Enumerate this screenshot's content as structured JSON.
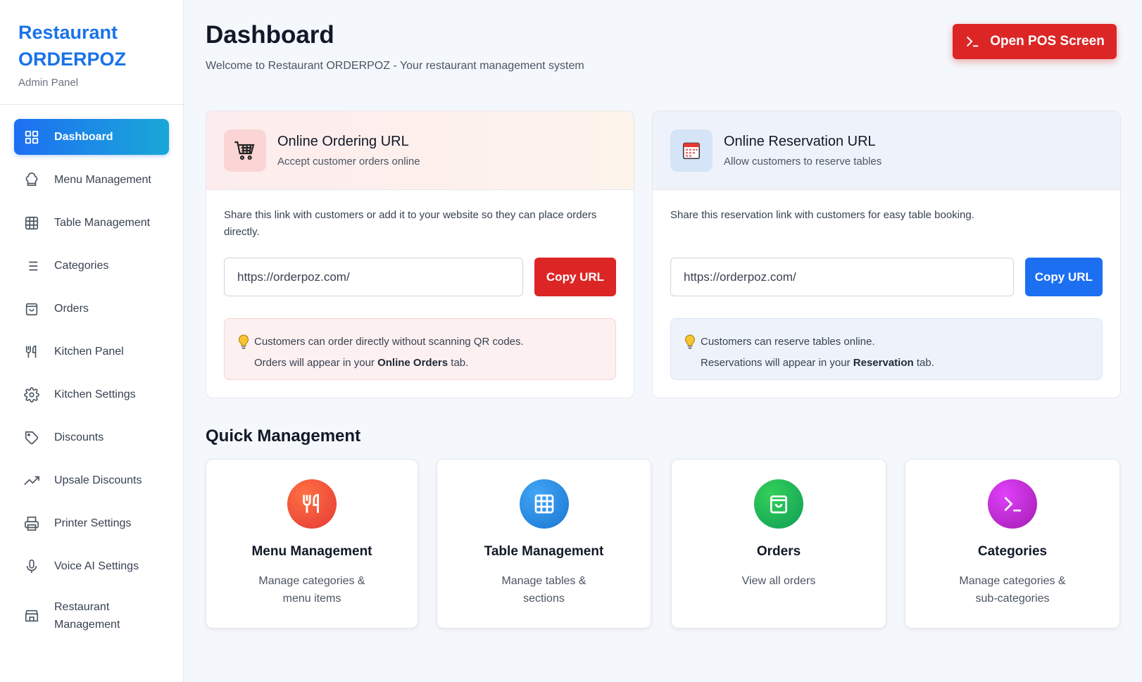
{
  "brand": {
    "title_line1": "Restaurant",
    "title_line2": "ORDERPOZ",
    "subtitle": "Admin Panel"
  },
  "sidebar": {
    "items": [
      {
        "label": "Dashboard",
        "icon": "grid-icon",
        "active": true
      },
      {
        "label": "Menu Management",
        "icon": "chef-hat-icon"
      },
      {
        "label": "Table Management",
        "icon": "table-grid-icon"
      },
      {
        "label": "Categories",
        "icon": "list-icon"
      },
      {
        "label": "Orders",
        "icon": "bag-icon"
      },
      {
        "label": "Kitchen Panel",
        "icon": "utensils-icon"
      },
      {
        "label": "Kitchen Settings",
        "icon": "gear-icon"
      },
      {
        "label": "Discounts",
        "icon": "tag-icon"
      },
      {
        "label": "Upsale Discounts",
        "icon": "trending-up-icon"
      },
      {
        "label": "Printer Settings",
        "icon": "printer-icon"
      },
      {
        "label": "Voice AI Settings",
        "icon": "microphone-icon"
      },
      {
        "label_line1": "Restaurant",
        "label_line2": "Management",
        "icon": "store-icon"
      }
    ]
  },
  "header": {
    "title": "Dashboard",
    "subtitle": "Welcome to Restaurant ORDERPOZ - Your restaurant management system",
    "pos_button": "Open POS Screen"
  },
  "ordering": {
    "title": "Online Ordering URL",
    "subtitle": "Accept customer orders online",
    "description": "Share this link with customers or add it to your website so they can place orders directly.",
    "url": "https://orderpoz.com/",
    "copy_label": "Copy URL",
    "tip_line1": "Customers can order directly without scanning QR codes.",
    "tip_line2_pre": "Orders will appear in your ",
    "tip_line2_bold": "Online Orders",
    "tip_line2_post": " tab.",
    "accent": "#dc2626"
  },
  "reservation": {
    "title": "Online Reservation URL",
    "subtitle": "Allow customers to reserve tables",
    "description": "Share this reservation link with customers for easy table booking.",
    "url": "https://orderpoz.com/",
    "copy_label": "Copy URL",
    "tip_line1": "Customers can reserve tables online.",
    "tip_line2_pre": "Reservations will appear in your ",
    "tip_line2_bold": "Reservation",
    "tip_line2_post": " tab.",
    "accent": "#1d6ff2"
  },
  "quick": {
    "title": "Quick Management",
    "cards": [
      {
        "name": "Menu Management",
        "desc": "Manage categories & menu items",
        "icon": "utensils-icon",
        "color": "#f4511e"
      },
      {
        "name": "Table Management",
        "desc": "Manage tables & sections",
        "icon": "table-grid-icon",
        "color": "#1e88e5"
      },
      {
        "name": "Orders",
        "desc": "View all orders",
        "icon": "bag-icon",
        "color": "#16a34a"
      },
      {
        "name": "Categories",
        "desc": "Manage categories & sub-categories",
        "icon": "terminal-icon",
        "color": "#c026d3"
      }
    ]
  }
}
